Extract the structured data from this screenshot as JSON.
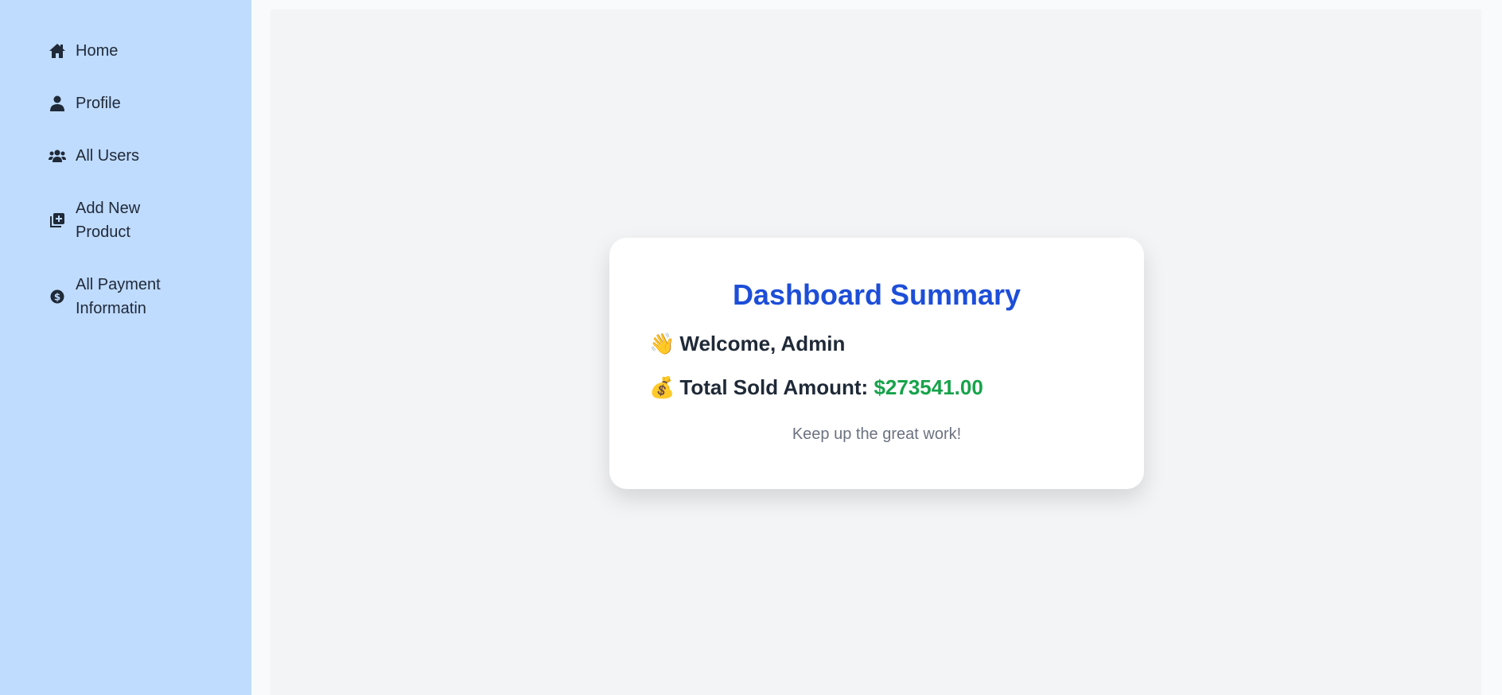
{
  "sidebar": {
    "items": [
      {
        "label": "Home",
        "icon": "home-icon"
      },
      {
        "label": "Profile",
        "icon": "user-icon"
      },
      {
        "label": "All Users",
        "icon": "users-icon"
      },
      {
        "label": "Add New Product",
        "icon": "add-box-icon"
      },
      {
        "label": "All Payment Informatin",
        "icon": "dollar-circle-icon"
      }
    ]
  },
  "card": {
    "title": "Dashboard Summary",
    "welcome_emoji": "👋",
    "welcome": "Welcome, Admin",
    "total_emoji": "💰",
    "total_label": "Total Sold Amount:",
    "total_value": "$273541.00",
    "note": "Keep up the great work!"
  },
  "colors": {
    "sidebar": "#bfdbfe",
    "title": "#1d4ed8",
    "amount": "#16a34a"
  }
}
